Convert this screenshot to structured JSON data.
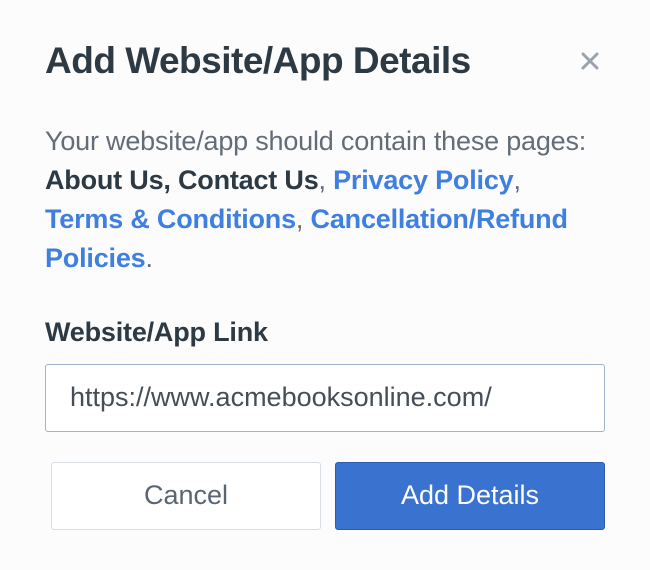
{
  "dialog": {
    "title": "Add Website/App Details",
    "info_prefix": "Your website/app should contain these pages: ",
    "pages": {
      "about_us": "About Us",
      "contact_us": "Contact Us",
      "privacy_policy": "Privacy Policy",
      "terms": "Terms & Conditions",
      "cancellation": "Cancellation/Refund Policies"
    },
    "field": {
      "label": "Website/App Link",
      "value": "https://www.acmebooksonline.com/"
    },
    "buttons": {
      "cancel": "Cancel",
      "submit": "Add Details"
    }
  }
}
